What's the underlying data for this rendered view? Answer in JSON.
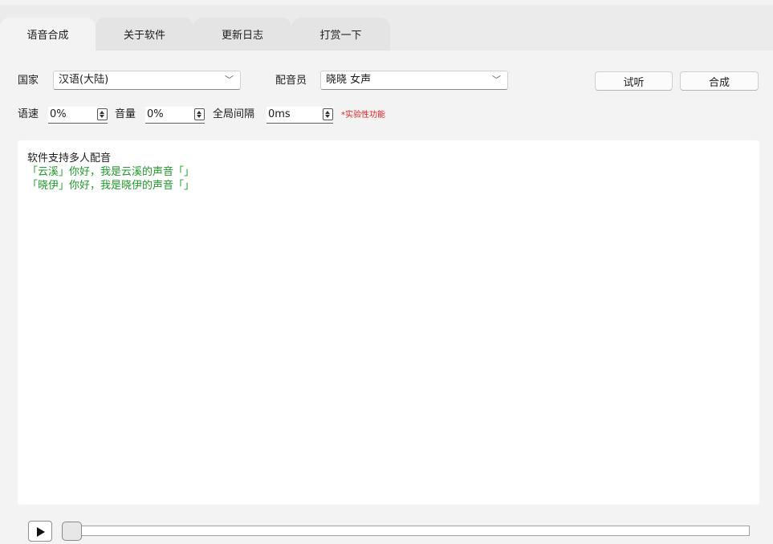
{
  "tabs": [
    {
      "label": "语音合成",
      "active": true
    },
    {
      "label": "关于软件",
      "active": false
    },
    {
      "label": "更新日志",
      "active": false
    },
    {
      "label": "打赏一下",
      "active": false
    }
  ],
  "settings": {
    "country_label": "国家",
    "country_value": "汉语(大陆)",
    "voice_label": "配音员",
    "voice_value": "晓晓 女声",
    "preview_button": "试听",
    "synthesize_button": "合成",
    "speed_label": "语速",
    "speed_value": "0%",
    "volume_label": "音量",
    "volume_value": "0%",
    "interval_label": "全局间隔",
    "interval_value": "0ms",
    "experimental_note": "*实验性功能"
  },
  "editor": {
    "lines": [
      {
        "text": "软件支持多人配音",
        "color": "#1b1b1b"
      },
      {
        "text": "「云溪」你好，我是云溪的声音「」",
        "color": "#1f9a2a"
      },
      {
        "text": "「晓伊」你好，我是晓伊的声音「」",
        "color": "#1f9a2a"
      }
    ]
  },
  "player": {
    "progress": 0
  },
  "colors": {
    "accent_green": "#1f9a2a",
    "warning_red": "#e02020"
  }
}
